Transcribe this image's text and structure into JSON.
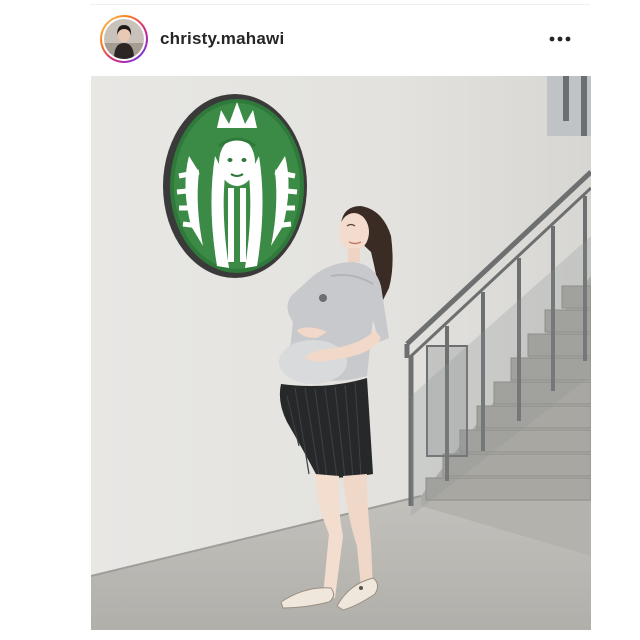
{
  "post": {
    "username": "christy.mahawi",
    "more_icon": "more-horizontal-icon"
  },
  "colors": {
    "username_text": "#262626",
    "starbucks_green": "#1e6b3a",
    "wall": "#e6e5e2"
  },
  "photo": {
    "subject": "person-posing-near-logo-sign",
    "sign_icon": "starbucks-siren-logo"
  }
}
